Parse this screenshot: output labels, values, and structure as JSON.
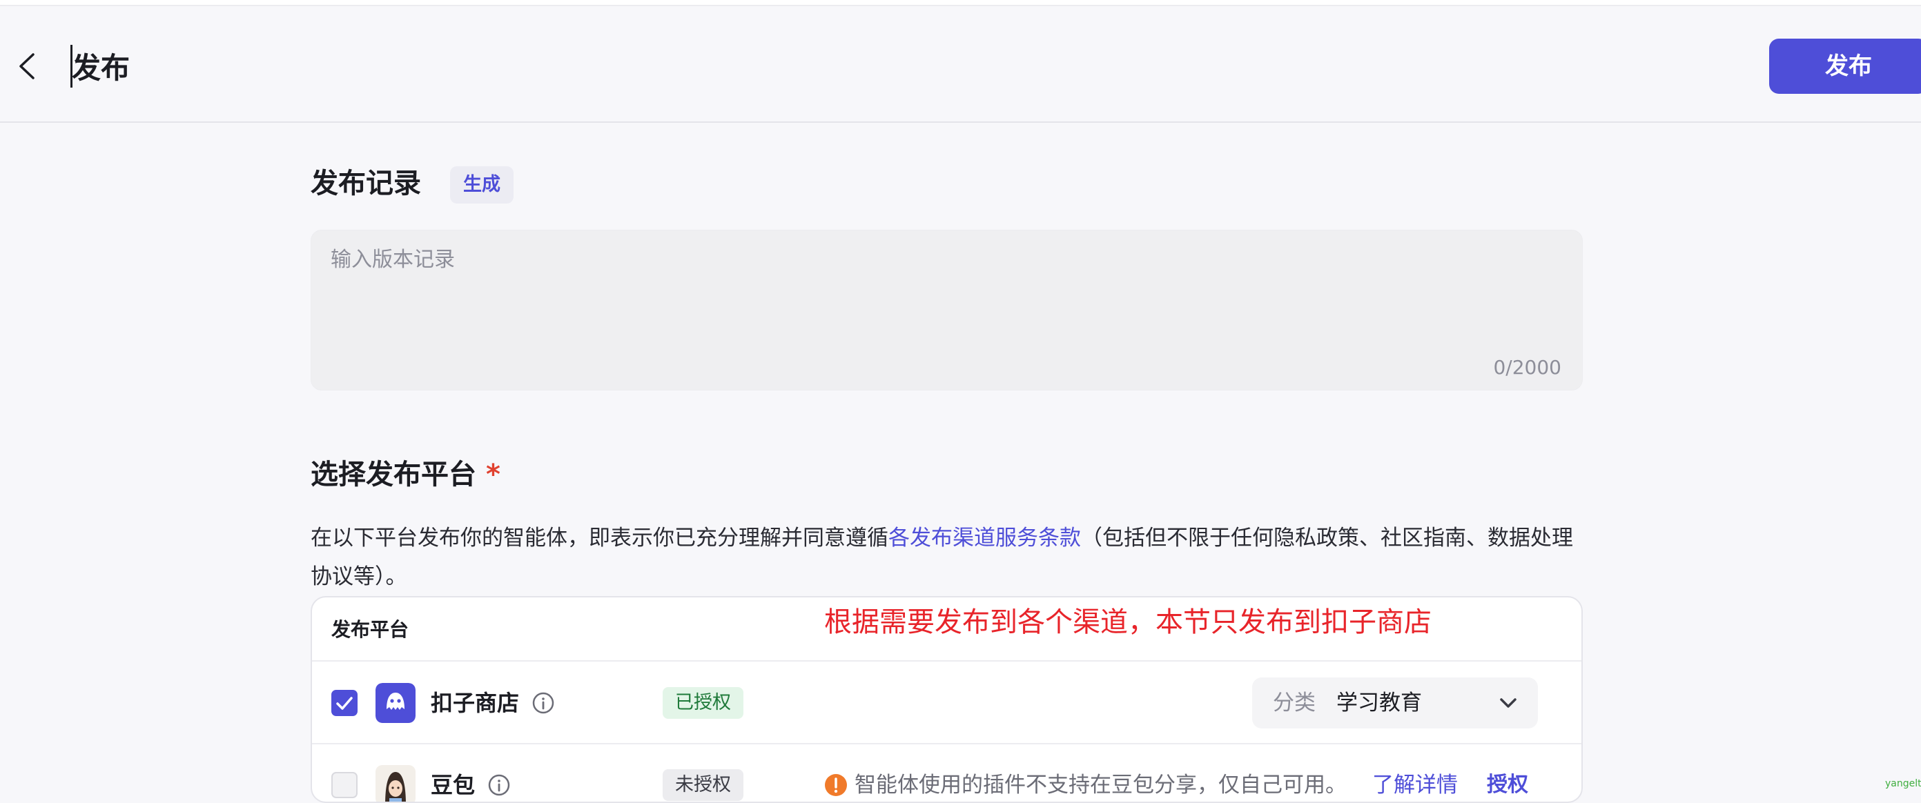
{
  "header": {
    "title": "发布",
    "publish_label": "发布"
  },
  "record": {
    "title": "发布记录",
    "generate_label": "生成",
    "placeholder": "输入版本记录",
    "counter": "0/2000"
  },
  "platform": {
    "title": "选择发布平台",
    "required_mark": "*",
    "desc_before": "在以下平台发布你的智能体，即表示你已充分理解并同意遵循",
    "desc_link": "各发布渠道服务条款",
    "desc_after": "（包括但不限于任何隐私政策、社区指南、数据处理协议等）。",
    "table_header": "发布平台",
    "annotation": "根据需要发布到各个渠道，本节只发布到扣子商店",
    "rows": [
      {
        "name": "扣子商店",
        "checked": true,
        "status": "已授权",
        "category_label": "分类",
        "category_value": "学习教育"
      },
      {
        "name": "豆包",
        "checked": false,
        "status": "未授权",
        "warning": "智能体使用的插件不支持在豆包分享，仅自己可用。",
        "learn_more": "了解详情",
        "authorize": "授权"
      }
    ]
  },
  "watermark": "yangelt",
  "colors": {
    "accent": "#4e4ed8",
    "annotation": "#e8242a",
    "warning": "#f07a2a",
    "authorized_bg": "#e3f5e8"
  },
  "icons": {
    "back": "chevron-left-icon",
    "info": "info-circle-icon",
    "warning": "exclamation-circle-icon",
    "dropdown": "chevron-down-icon",
    "check": "check-icon"
  }
}
